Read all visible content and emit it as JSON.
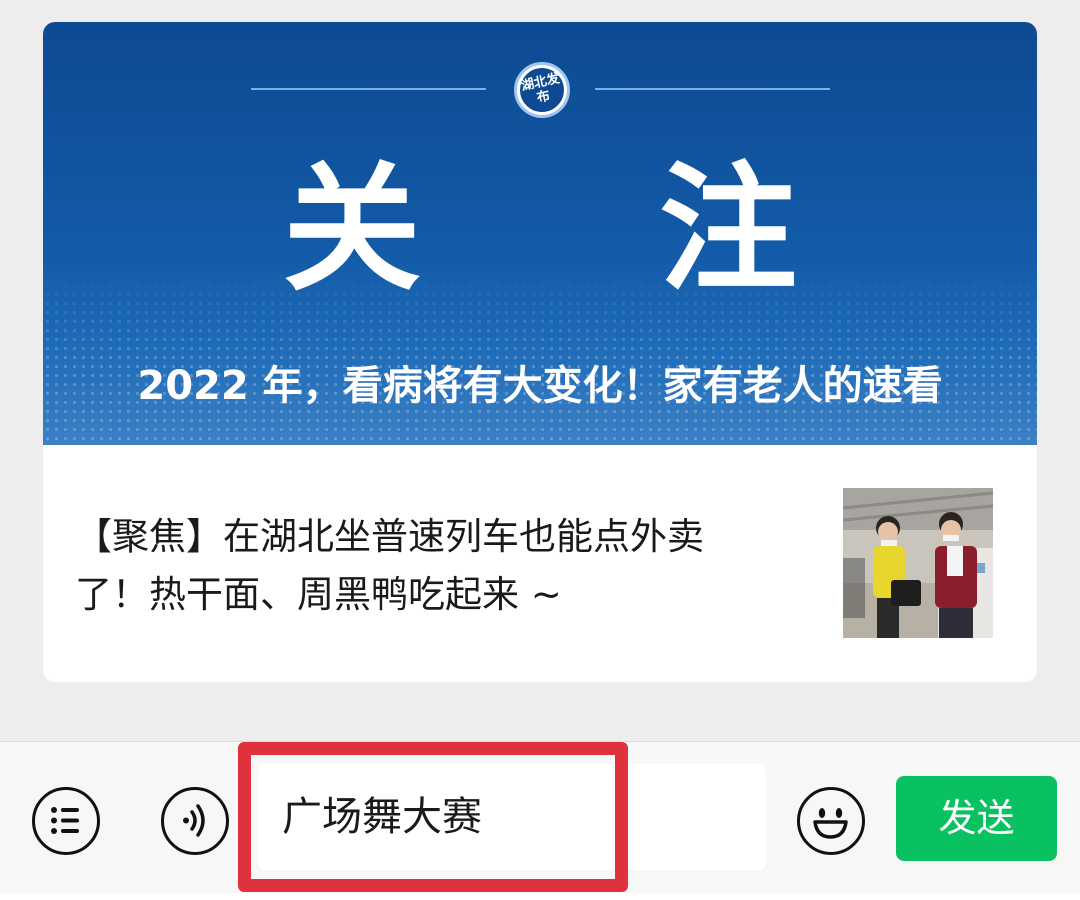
{
  "card": {
    "banner": {
      "logo_text": "湖北发布",
      "title": "关 注",
      "headline": "2022 年，看病将有大变化！家有老人的速看"
    },
    "article": {
      "title": "【聚焦】在湖北坐普速列车也能点外卖了！热干面、周黑鸭吃起来 ~"
    }
  },
  "input_bar": {
    "menu_icon": "list-menu-icon",
    "voice_icon": "voice-icon",
    "input_value": "广场舞大赛",
    "emoji_icon": "smiley-icon",
    "send_label": "发送"
  },
  "colors": {
    "banner_blue": "#0d4a92",
    "send_green": "#09c160",
    "highlight_red": "#e0323c"
  }
}
